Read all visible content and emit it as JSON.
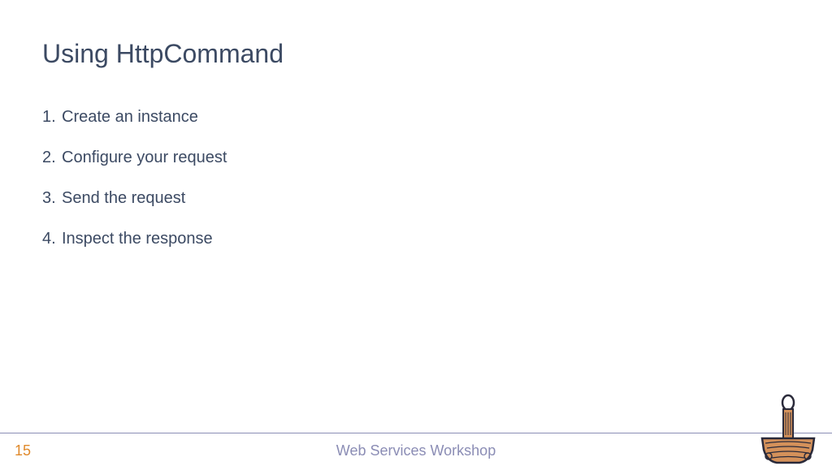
{
  "title": {
    "prefix": "Using ",
    "code": "HttpCommand"
  },
  "items": [
    {
      "num": "1.",
      "text": "Create an instance"
    },
    {
      "num": "2.",
      "text": "Configure your request"
    },
    {
      "num": "3.",
      "text": "Send the request"
    },
    {
      "num": "4.",
      "text": "Inspect the response"
    }
  ],
  "footer": {
    "page": "15",
    "title": "Web Services Workshop"
  }
}
